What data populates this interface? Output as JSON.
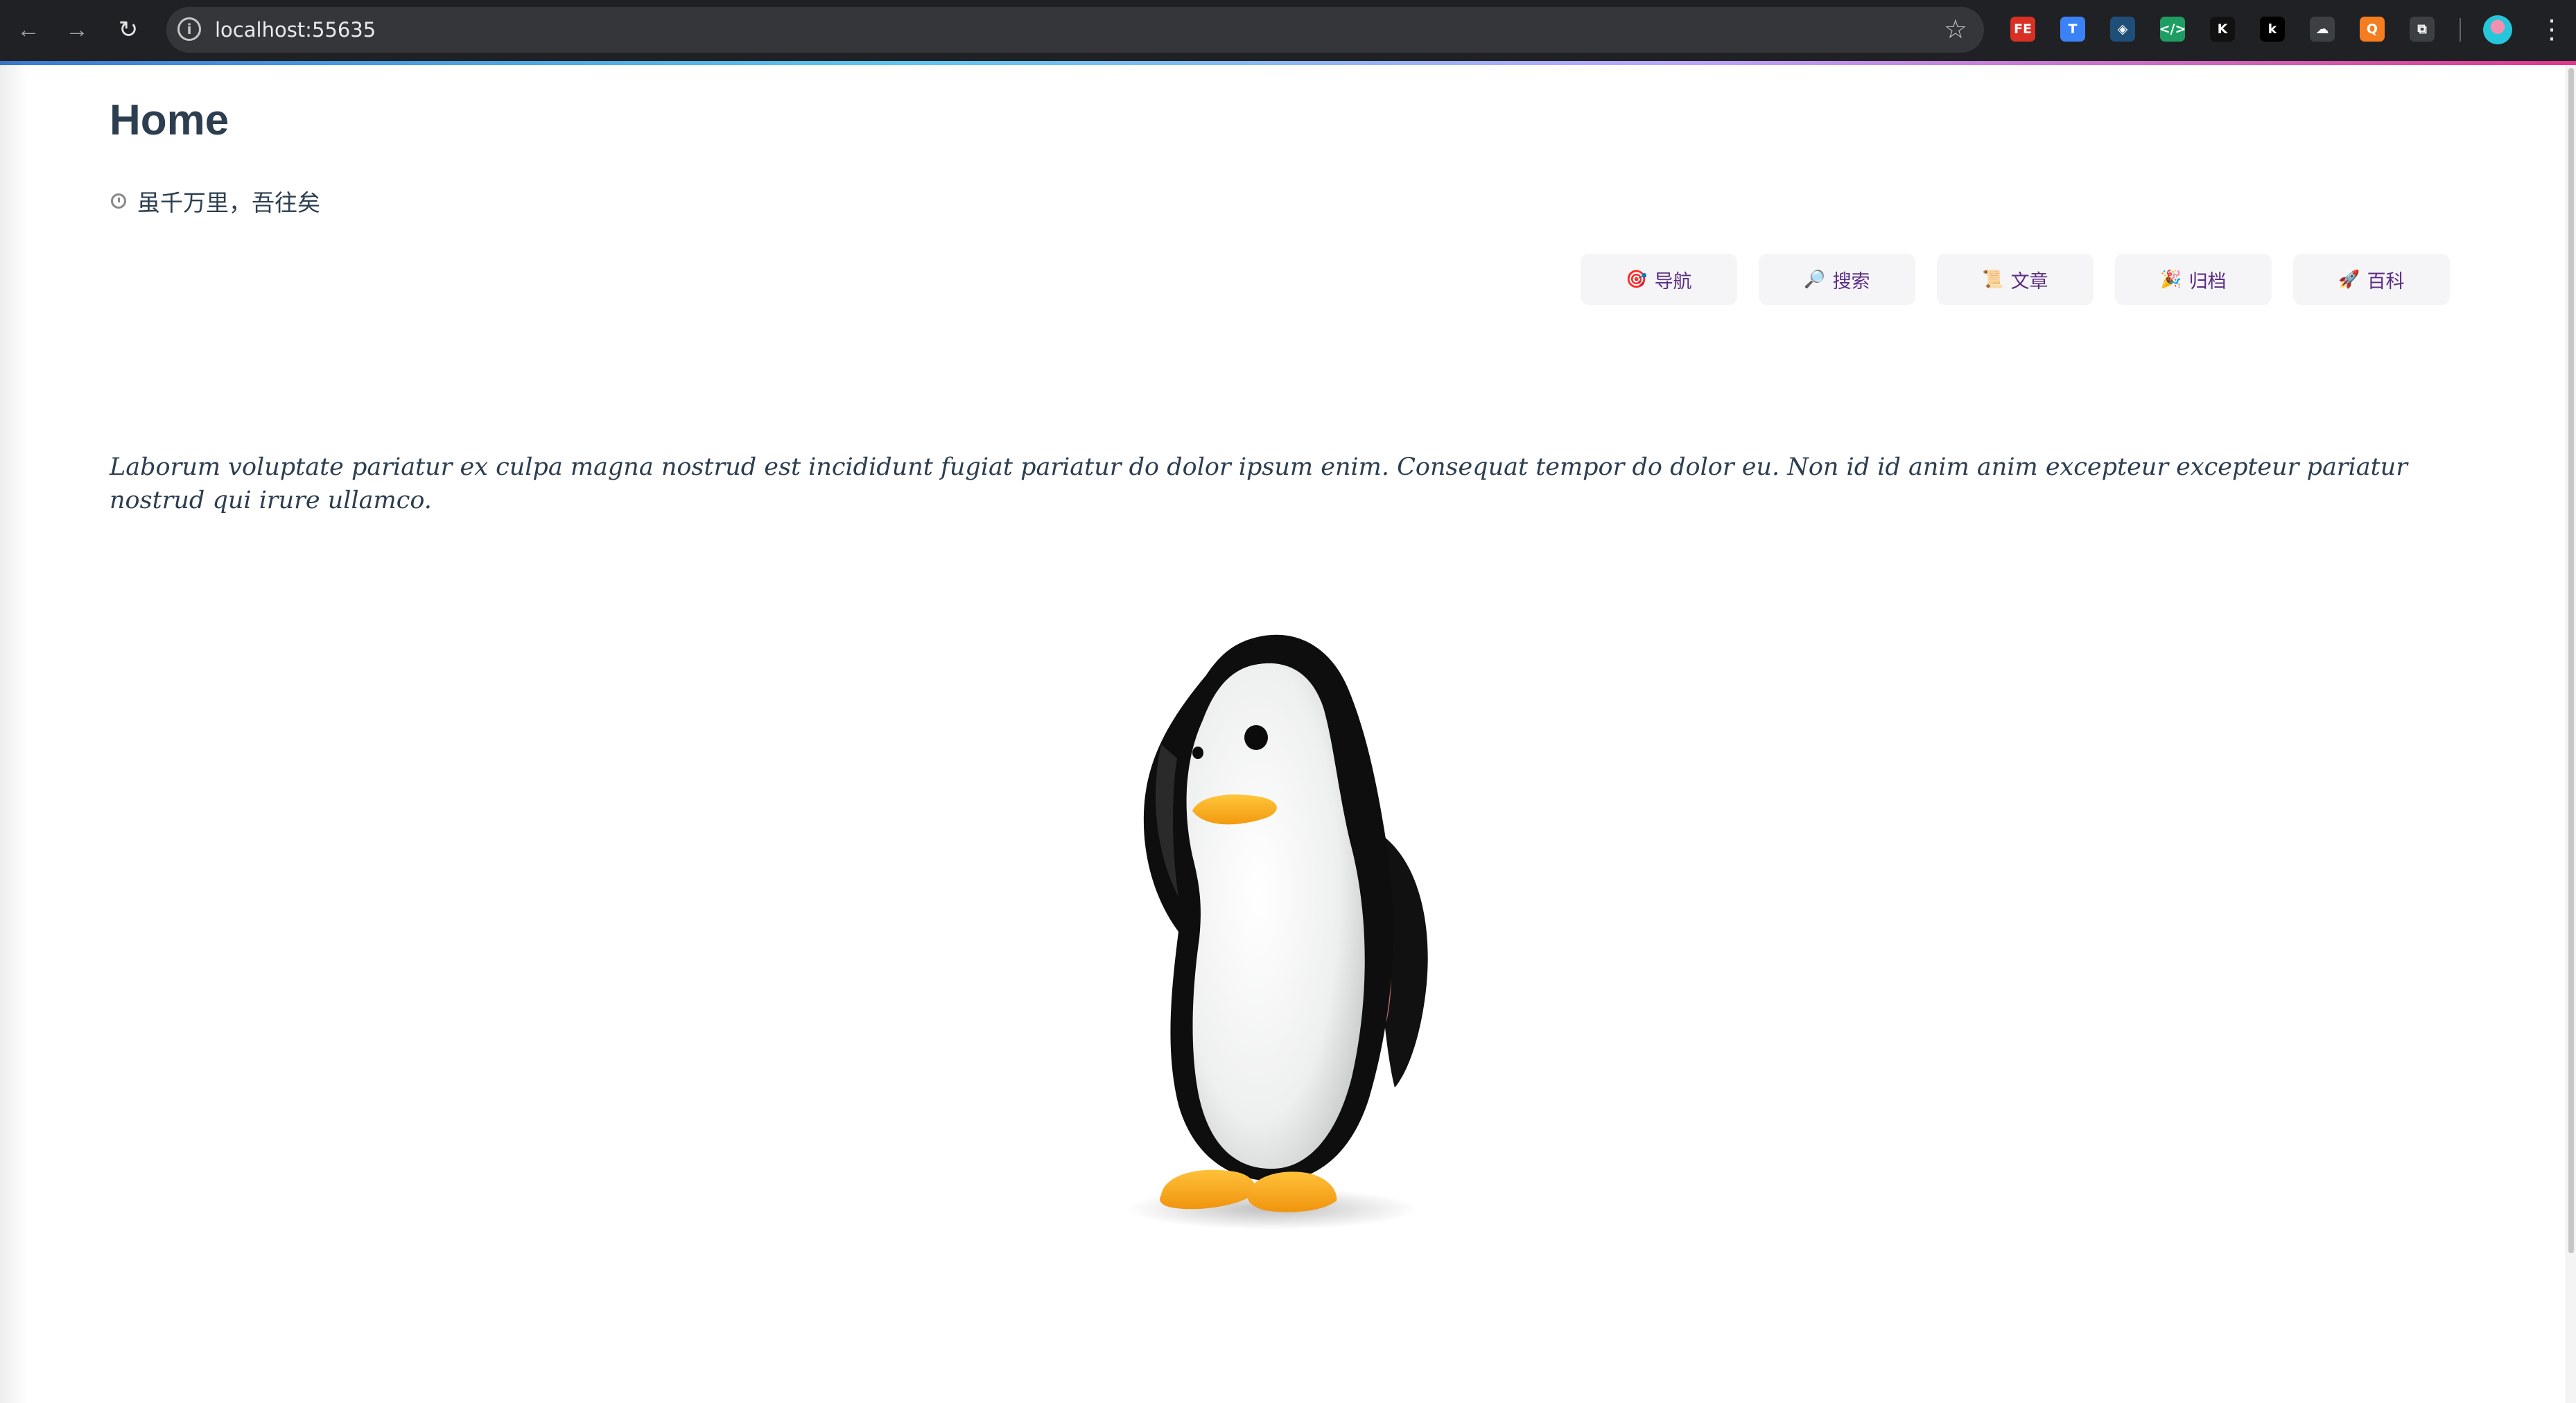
{
  "browser": {
    "url": "localhost:55635",
    "back_icon": "arrow-left-icon",
    "forward_icon": "arrow-right-icon",
    "reload_icon": "reload-icon",
    "extensions": [
      {
        "label": "FE",
        "color": "#d93025"
      },
      {
        "label": "T",
        "color": "#3b82f6"
      },
      {
        "label": "◈",
        "color": "#1f4e79"
      },
      {
        "label": "</>",
        "color": "#1e9e63"
      },
      {
        "label": "K",
        "color": "#111111"
      },
      {
        "label": "k",
        "color": "#000000"
      },
      {
        "label": "☁",
        "color": "#3c4043"
      },
      {
        "label": "Q",
        "color": "#f57c1f"
      },
      {
        "label": "⧉",
        "color": "#3c4043"
      }
    ]
  },
  "page": {
    "title": "Home",
    "motto": "虽千万里，吾往矣",
    "nav": [
      {
        "icon": "🎯",
        "label": "导航"
      },
      {
        "icon": "🔎",
        "label": "搜索"
      },
      {
        "icon": "📜",
        "label": "文章"
      },
      {
        "icon": "🎉",
        "label": "归档"
      },
      {
        "icon": "🚀",
        "label": "百科"
      }
    ],
    "lead": "Laborum voluptate pariatur ex culpa magna nostrud est incididunt fugiat pariatur do dolor ipsum enim. Consequat tempor do dolor eu. Non id id anim anim excepteur excepteur pariatur nostrud qui irure ullamco.",
    "hero_image": "penguin-illustration"
  },
  "colors": {
    "title": "#2c3e50",
    "nav_text": "#5b2c83",
    "nav_bg": "#f5f5f7",
    "browser_bg": "#202124"
  }
}
